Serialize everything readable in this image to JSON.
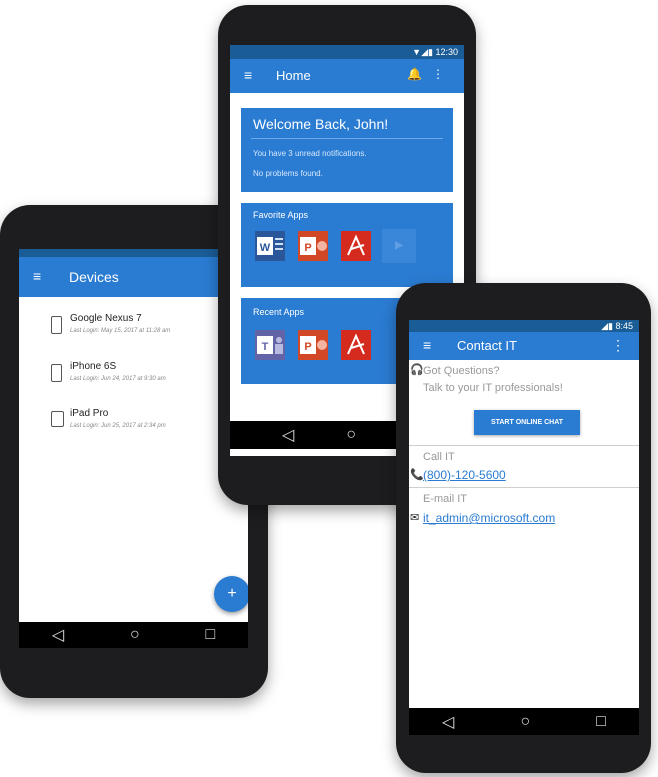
{
  "devices": {
    "title": "Devices",
    "menu_icon": "≡",
    "items": [
      {
        "name": "Google Nexus 7",
        "last_login": "Last Login: May 15, 2017 at 11:28 am"
      },
      {
        "name": "iPhone 6S",
        "last_login": "Last Login: Jun 24, 2017 at 9:30 am"
      },
      {
        "name": "iPad Pro",
        "last_login": "Last Login: Jun 25, 2017 at 2:34 pm"
      }
    ],
    "fab_label": "+",
    "nav": {
      "back": "◁",
      "home": "○",
      "recent": "□"
    }
  },
  "home": {
    "status_time": "12:30",
    "status_icons": "▼◢▮",
    "title": "Home",
    "menu_icon": "≡",
    "bell_icon": "🔔",
    "more_icon": "⋮",
    "welcome_title": "Welcome Back, John!",
    "notifications_text": "You have 3 unread notifications.",
    "problems_text": "No problems found.",
    "favorite_title": "Favorite Apps",
    "recent_title": "Recent Apps",
    "nav": {
      "back": "◁",
      "home": "○"
    }
  },
  "contact": {
    "status_time": "8:45",
    "status_icons": "◢▮",
    "title": "Contact IT",
    "menu_icon": "≡",
    "more_icon": "⋮",
    "got_questions": "Got Questions?",
    "talk_to": "Talk to your IT professionals!",
    "chat_button": "START ONLINE CHAT",
    "call_label": "Call IT",
    "phone": "(800)-120-5600",
    "email_label": "E-mail IT",
    "email": "it_admin@microsoft.com",
    "headset_icon": "🎧",
    "phone_icon": "📞",
    "mail_icon": "✉",
    "nav": {
      "back": "◁",
      "home": "○",
      "recent": "□"
    }
  },
  "colors": {
    "accent": "#2a7bd2",
    "status_bar": "#1a5c96",
    "word": "#2b579a",
    "powerpoint": "#d24726",
    "acrobat": "#d52b1e",
    "teams": "#6264a7"
  }
}
